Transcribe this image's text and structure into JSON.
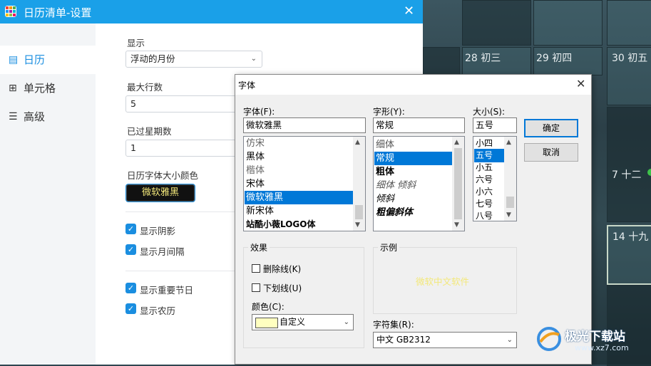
{
  "background_calendar": {
    "cells": [
      "28 初三",
      "29 初四",
      "30 初五",
      "7 十二",
      "14 十九"
    ]
  },
  "settings": {
    "title": "日历清单-设置",
    "sidebar": {
      "items": [
        {
          "label": "日历",
          "icon": "calendar-icon",
          "active": true
        },
        {
          "label": "单元格",
          "icon": "grid-icon",
          "active": false
        },
        {
          "label": "高级",
          "icon": "sliders-icon",
          "active": false
        }
      ]
    },
    "display_label": "显示",
    "display_value": "浮动的月份",
    "max_rows_label": "最大行数",
    "max_rows_value": "5",
    "past_weeks_label": "已过星期数",
    "past_weeks_value": "1",
    "font_color_label": "日历字体大小颜色",
    "font_color_button": "微软雅黑",
    "checkboxes": {
      "shadow": "显示阴影",
      "month_gap": "显示月间隔",
      "holidays": "显示重要节日",
      "lunar": "显示农历"
    }
  },
  "font_dialog": {
    "title": "字体",
    "font_label": "字体(F):",
    "font_value": "微软雅黑",
    "font_list": [
      "仿宋",
      "黑体",
      "楷体",
      "宋体",
      "微软雅黑",
      "新宋体",
      "站酷小薇LOGO体"
    ],
    "font_selected": "微软雅黑",
    "style_label": "字形(Y):",
    "style_value": "常规",
    "style_list": [
      "细体",
      "常规",
      "粗体",
      "细体 倾斜",
      "倾斜",
      "粗偏斜体"
    ],
    "style_selected": "常规",
    "size_label": "大小(S):",
    "size_value": "五号",
    "size_list": [
      "小四",
      "五号",
      "小五",
      "六号",
      "小六",
      "七号",
      "八号"
    ],
    "size_selected": "五号",
    "ok_label": "确定",
    "cancel_label": "取消",
    "effects_label": "效果",
    "strikeout_label": "删除线(K)",
    "underline_label": "下划线(U)",
    "color_label": "颜色(C):",
    "color_value": "自定义",
    "color_swatch": "#ffffc0",
    "sample_label": "示例",
    "sample_text": "微软中文软件",
    "charset_label": "字符集(R):",
    "charset_value": "中文 GB2312"
  },
  "watermark": {
    "text": "极光下载站",
    "url_text": "www.xz7.com"
  },
  "colors": {
    "accent": "#1aa0e8",
    "selection": "#0078d7",
    "sample_text": "#f3e87a"
  }
}
